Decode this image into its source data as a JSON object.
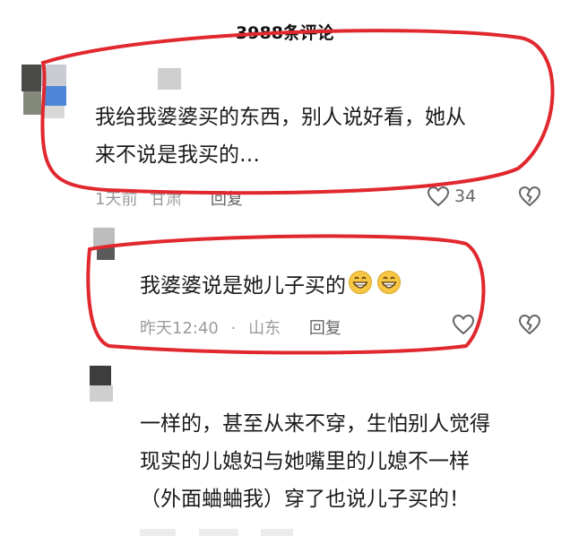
{
  "header": {
    "title": "3988条评论"
  },
  "comments": [
    {
      "lines": [
        "我给我婆婆买的东西，别人说好看，她从",
        "来不说是我买的…"
      ],
      "time": "1天前",
      "location": "甘肃",
      "reply_label": "回复",
      "like_count": "34"
    },
    {
      "lines": [
        "我婆婆说是她儿子买的"
      ],
      "time": "昨天12:40",
      "location": "山东",
      "reply_label": "回复",
      "like_count": ""
    },
    {
      "lines": [
        "一样的，甚至从来不穿，生怕别人觉得",
        "现实的儿媳妇与她嘴里的儿媳不一样",
        "（外面蛐蛐我）穿了也说儿子买的！"
      ],
      "time": "",
      "location": "",
      "reply_label": "",
      "like_count": ""
    }
  ],
  "icons": {
    "like": "heart-outline-icon",
    "dislike": "broken-heart-icon",
    "emoji": "grinning-face-emoji"
  },
  "colors": {
    "annotation": "#e0282e",
    "meta": "#9b9b9b",
    "emoji": "#f7c744"
  }
}
